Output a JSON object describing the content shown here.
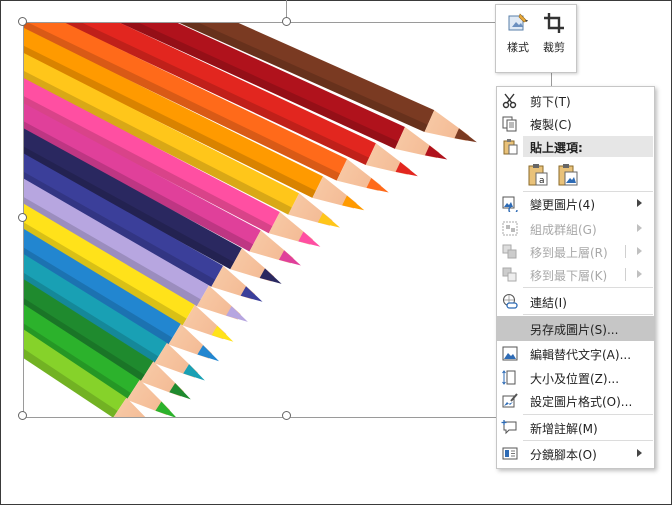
{
  "mini_toolbar": {
    "style_label": "樣式",
    "crop_label": "裁剪"
  },
  "context_menu": {
    "cut": "剪下(T)",
    "copy": "複製(C)",
    "paste_options": "貼上選項:",
    "change_picture": "變更圖片(4)",
    "group": "組成群組(G)",
    "bring_to_front": "移到最上層(R)",
    "send_to_back": "移到最下層(K)",
    "link": "連結(I)",
    "save_as_picture": "另存成圖片(S)...",
    "edit_alt_text": "編輯替代文字(A)...",
    "size_position": "大小及位置(Z)...",
    "format_picture": "設定圖片格式(O)...",
    "new_comment": "新增註解(M)",
    "storyboard": "分鏡腳本(O)"
  },
  "colors": {
    "highlight": "#c6c6c6",
    "accent_blue": "#2e6bb5"
  },
  "icons": [
    "scissors-icon",
    "copy-icon",
    "clipboard-icon",
    "paste-keep-text-icon",
    "paste-picture-icon",
    "change-picture-icon",
    "group-icon",
    "bring-front-icon",
    "send-back-icon",
    "link-icon",
    "alt-text-icon",
    "size-icon",
    "format-picture-icon",
    "comment-icon",
    "storyboard-icon",
    "style-icon",
    "crop-icon"
  ]
}
